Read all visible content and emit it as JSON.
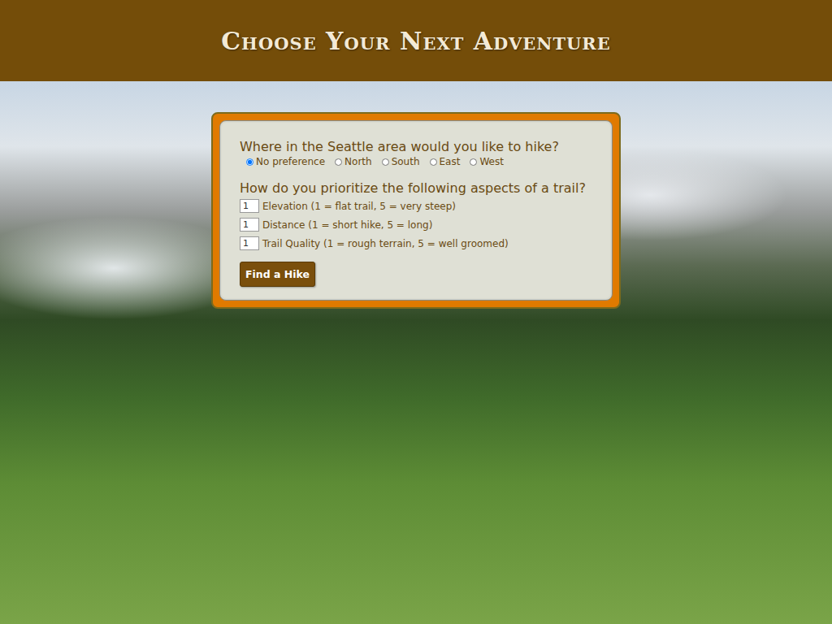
{
  "header": {
    "title": "Choose Your Next Adventure"
  },
  "form": {
    "location": {
      "question": "Where in the Seattle area would you like to hike?",
      "options": [
        {
          "label": "No preference",
          "selected": true
        },
        {
          "label": "North",
          "selected": false
        },
        {
          "label": "South",
          "selected": false
        },
        {
          "label": "East",
          "selected": false
        },
        {
          "label": "West",
          "selected": false
        }
      ]
    },
    "priorities": {
      "question": "How do you prioritize the following aspects of a trail?",
      "fields": [
        {
          "value": "1",
          "label": "Elevation (1 = flat trail, 5 = very steep)"
        },
        {
          "value": "1",
          "label": "Distance (1 = short hike, 5 = long)"
        },
        {
          "value": "1",
          "label": "Trail Quality (1 = rough terrain, 5 = well groomed)"
        }
      ]
    },
    "button": "Find a Hike"
  }
}
